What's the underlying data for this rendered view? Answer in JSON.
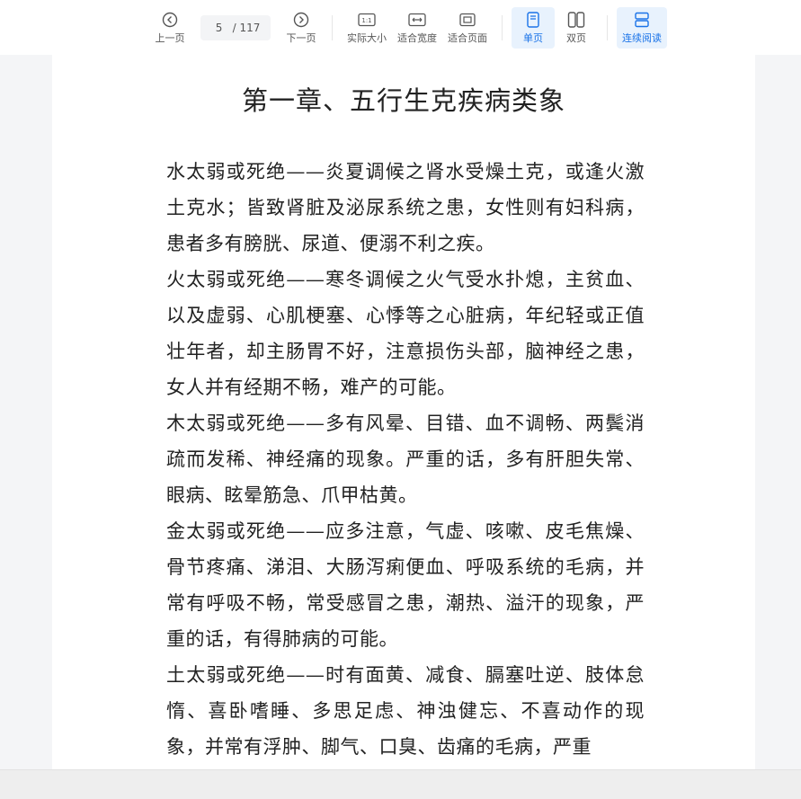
{
  "toolbar": {
    "prev_label": "上一页",
    "current_page": "5",
    "total_pages": "/ 117",
    "next_label": "下一页",
    "actual_size_label": "实际大小",
    "fit_width_label": "适合宽度",
    "fit_page_label": "适合页面",
    "single_page_label": "单页",
    "double_page_label": "双页",
    "continuous_label": "连续阅读",
    "active_color": "#1a73e8"
  },
  "document": {
    "chapter_title": "第一章、五行生克疾病类象",
    "paragraphs": [
      "水太弱或死绝——炎夏调候之肾水受燥土克，或逢火激土克水；皆致肾脏及泌尿系统之患，女性则有妇科病，患者多有膀胱、尿道、便溺不利之疾。",
      "火太弱或死绝——寒冬调候之火气受水扑熄，主贫血、以及虚弱、心肌梗塞、心悸等之心脏病，年纪轻或正值壮年者，却主肠胃不好，注意损伤头部，脑神经之患，女人并有经期不畅，难产的可能。",
      "木太弱或死绝——多有风晕、目错、血不调畅、两鬓消疏而发稀、神经痛的现象。严重的话，多有肝胆失常、眼病、眩晕筋急、爪甲枯黄。",
      "金太弱或死绝——应多注意，气虚、咳嗽、皮毛焦燥、骨节疼痛、涕泪、大肠泻痢便血、呼吸系统的毛病，并常有呼吸不畅，常受感冒之患，潮热、溢汗的现象，严重的话，有得肺病的可能。",
      "土太弱或死绝——时有面黄、减食、膈塞吐逆、肢体怠惰、喜卧嗜睡、多思足虑、神浊健忘、不喜动作的现象，并常有浮肿、脚气、口臭、齿痛的毛病，严重"
    ]
  }
}
